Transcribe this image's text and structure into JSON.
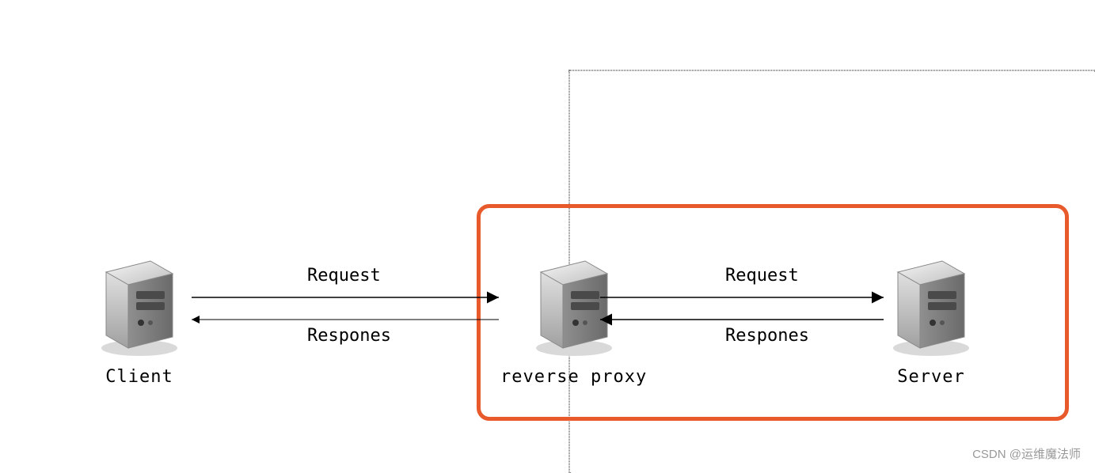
{
  "nodes": {
    "client": {
      "label": "Client"
    },
    "proxy": {
      "label": "reverse proxy"
    },
    "server": {
      "label": "Server"
    }
  },
  "arrows": {
    "cp_req": {
      "label": "Request"
    },
    "cp_res": {
      "label": "Respones"
    },
    "ps_req": {
      "label": "Request"
    },
    "ps_res": {
      "label": "Respones"
    }
  },
  "watermark": "CSDN @运维魔法师"
}
